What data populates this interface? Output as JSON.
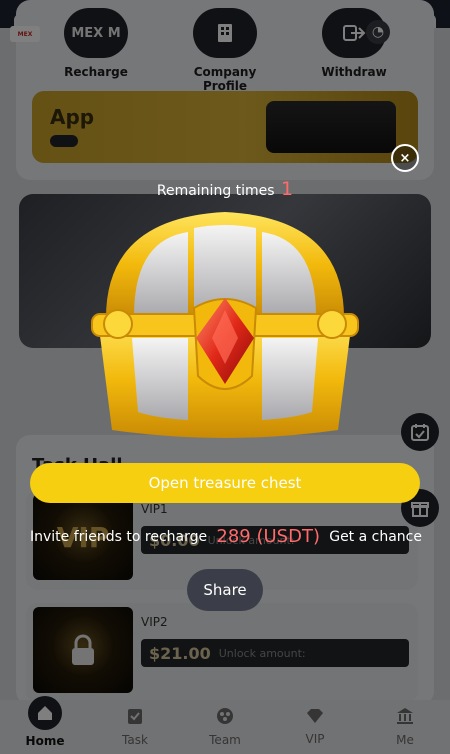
{
  "quick_actions": [
    {
      "label": "Recharge",
      "icon": "recharge-icon"
    },
    {
      "label": "Company Profile",
      "icon": "building-icon"
    },
    {
      "label": "Withdraw",
      "icon": "withdraw-icon"
    }
  ],
  "logo_text": "MEX",
  "recharge_overlay_text": "MEX M",
  "banner": {
    "title": "App"
  },
  "task_hall": {
    "title": "Task Hall"
  },
  "vip_levels": [
    {
      "name": "VIP1",
      "price": "$0.00",
      "unlock_label": "Unlock amount:"
    },
    {
      "name": "VIP2",
      "price": "$21.00",
      "unlock_label": "Unlock amount:"
    }
  ],
  "tabs": [
    {
      "label": "Home",
      "icon": "home-icon",
      "active": true
    },
    {
      "label": "Task",
      "icon": "task-icon",
      "active": false
    },
    {
      "label": "Team",
      "icon": "team-icon",
      "active": false
    },
    {
      "label": "VIP",
      "icon": "diamond-icon",
      "active": false
    },
    {
      "label": "Me",
      "icon": "bank-icon",
      "active": false
    }
  ],
  "treasure": {
    "remaining_label": "Remaining times",
    "remaining_count": "1",
    "open_button": "Open treasure chest",
    "invite_text": "Invite friends to recharge",
    "invite_amount": "289 (USDT)",
    "invite_suffix": "Get a chance",
    "share_button": "Share",
    "close_symbol": "×"
  },
  "colors": {
    "accent_yellow": "#f5cf10",
    "highlight_red": "#ff6b6b",
    "dark": "#1f2228"
  }
}
